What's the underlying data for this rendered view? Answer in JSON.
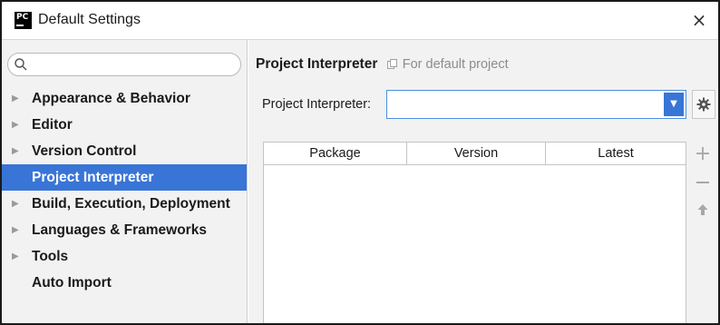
{
  "window": {
    "title": "Default Settings",
    "app_icon_text": "PC",
    "close_glyph": "×"
  },
  "sidebar": {
    "search": {
      "value": "",
      "placeholder": ""
    },
    "items": [
      {
        "label": "Appearance & Behavior",
        "expandable": true,
        "selected": false
      },
      {
        "label": "Editor",
        "expandable": true,
        "selected": false
      },
      {
        "label": "Version Control",
        "expandable": true,
        "selected": false
      },
      {
        "label": "Project Interpreter",
        "expandable": false,
        "selected": true
      },
      {
        "label": "Build, Execution, Deployment",
        "expandable": true,
        "selected": false
      },
      {
        "label": "Languages & Frameworks",
        "expandable": true,
        "selected": false
      },
      {
        "label": "Tools",
        "expandable": true,
        "selected": false
      },
      {
        "label": "Auto Import",
        "expandable": false,
        "selected": false
      }
    ]
  },
  "main": {
    "header": {
      "title": "Project Interpreter",
      "subtitle": "For default project"
    },
    "interpreter": {
      "label": "Project Interpreter:",
      "value": ""
    },
    "table": {
      "columns": [
        "Package",
        "Version",
        "Latest"
      ],
      "rows": []
    },
    "toolbar": {
      "add_glyph": "+"
    }
  },
  "colors": {
    "selection": "#3875d7",
    "sidebar_bg": "#f2f2f2",
    "panel_bg": "#f2f2f2",
    "focus_border": "#4a90e2",
    "muted_text": "#8c8c8c"
  },
  "icons": {
    "app": "pycharm-logo-icon",
    "search": "search-icon",
    "close": "close-icon",
    "expand": "triangle-right-icon",
    "copy": "copy-icon",
    "dropdown": "chevron-down-icon",
    "settings": "gear-icon",
    "add": "plus-icon",
    "remove": "minus-icon",
    "upgrade": "arrow-up-icon"
  }
}
